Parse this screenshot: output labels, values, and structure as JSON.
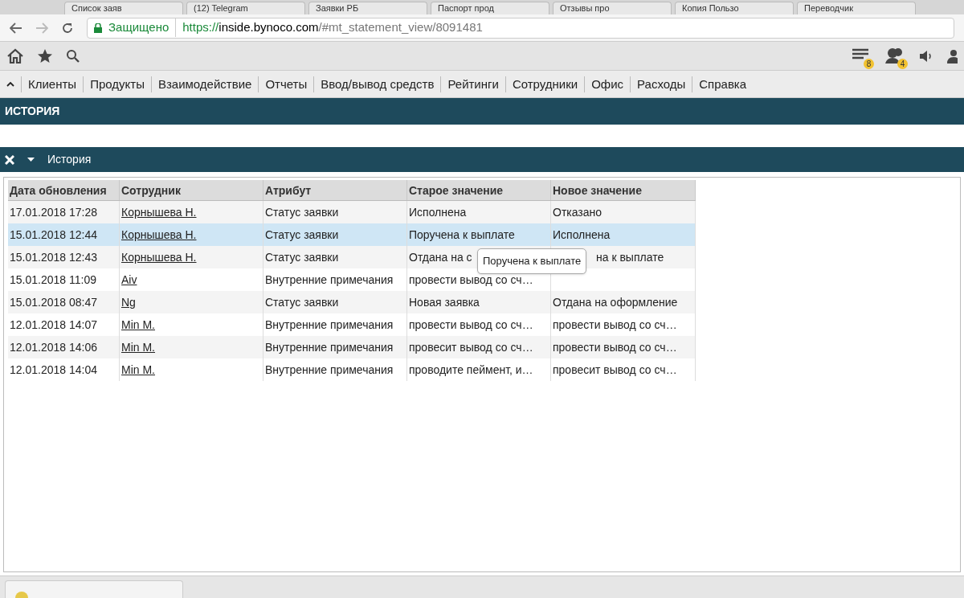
{
  "browser_tabs": [
    {
      "title": "Список заяв"
    },
    {
      "title": "(12) Telegram"
    },
    {
      "title": "Заявки РБ"
    },
    {
      "title": "Паспорт прод"
    },
    {
      "title": "Отзывы про"
    },
    {
      "title": "Копия Пользо"
    },
    {
      "title": "Переводчик"
    }
  ],
  "address_bar": {
    "secure_label": "Защищено",
    "url_scheme": "https://",
    "url_host": "inside.bynoco.com",
    "url_path": "/#mt_statement_view/8091481"
  },
  "toolbar": {
    "badges": [
      {
        "kind": "list",
        "count": "8"
      },
      {
        "kind": "people",
        "count": "4"
      }
    ]
  },
  "menu": {
    "items": [
      "Клиенты",
      "Продукты",
      "Взаимодействие",
      "Отчеты",
      "Ввод/вывод средств",
      "Рейтинги",
      "Сотрудники",
      "Офис",
      "Расходы",
      "Справка"
    ]
  },
  "page_title": "ИСТОРИЯ",
  "panel": {
    "title": "История",
    "expanded": true
  },
  "table": {
    "columns": [
      "Дата обновления",
      "Сотрудник",
      "Атрибут",
      "Старое значение",
      "Новое значение"
    ],
    "rows": [
      {
        "date": "17.01.2018 17:28",
        "employee": "Корнышева Н.",
        "attribute": "Статус заявки",
        "old": "Исполнена",
        "new": "Отказано",
        "selected": false
      },
      {
        "date": "15.01.2018 12:44",
        "employee": "Корнышева Н.",
        "attribute": "Статус заявки",
        "old": "Поручена к выплате",
        "new": "Исполнена",
        "selected": true
      },
      {
        "date": "15.01.2018 12:43",
        "employee": "Корнышева Н.",
        "attribute": "Статус заявки",
        "old": "Отдана на с",
        "new": "на к выплате",
        "selected": false,
        "tooltip": "Поручена к выплате"
      },
      {
        "date": "15.01.2018 11:09",
        "employee": "Aiv",
        "attribute": "Внутренние примечания",
        "old": "провести вывод со сч…",
        "selected": false
      },
      {
        "date": "15.01.2018 08:47",
        "employee": "Ng",
        "attribute": "Статус заявки",
        "old": "Новая заявка",
        "new": "Отдана на оформление",
        "selected": false
      },
      {
        "date": "12.01.2018 14:07",
        "employee": "Min M.",
        "attribute": "Внутренние примечания",
        "old": "провести вывод со сч…",
        "new": "провести вывод со сч…",
        "selected": false
      },
      {
        "date": "12.01.2018 14:06",
        "employee": "Min M.",
        "attribute": "Внутренние примечания",
        "old": "провесит вывод со сч…",
        "new": "провести вывод со сч…",
        "selected": false
      },
      {
        "date": "12.01.2018 14:04",
        "employee": "Min M.",
        "attribute": "Внутренние примечания",
        "old": "проводите пеймент, и…",
        "new": "провесит вывод со сч…",
        "selected": false
      }
    ]
  }
}
